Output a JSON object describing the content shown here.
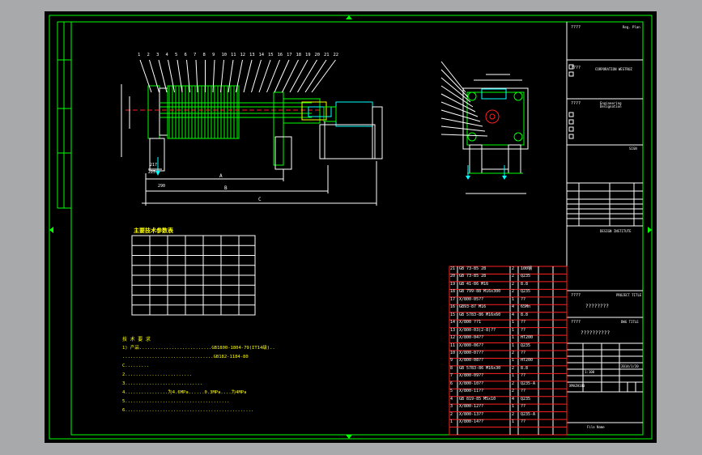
{
  "drawing": {
    "title_block": {
      "top_label": "????",
      "reg_label": "Reg. Plan",
      "corp_label": "????",
      "corp_text": "CORPORATION WESTRUZ",
      "eng_label": "????",
      "eng_text": "Engineering Designation",
      "sig_label": "SIGN",
      "design_label": "DESIGN INSTITUTE",
      "project_label": "????",
      "project_text": "PROJECT TITLE",
      "project_value": "????????",
      "dwg_label": "????",
      "dwg_text": "DWG TITLE",
      "dwg_value": "??????????",
      "model_value": "XMAZH180",
      "ratio_value": "1:100",
      "date_value": "2014/1/20",
      "file_label": "File Name"
    },
    "param_table": {
      "title": "主要技术参数表",
      "rows": 7
    },
    "notes": {
      "title": "技 术 要 求",
      "lines": [
        "1) 产品...........................GB1800-1804-79(IT14级)..",
        "   ..................................GB182-1184-80",
        "C.........",
        "2.........................",
        "3.............................",
        "4................为4.6MPa......0.3MPa....为4MPa",
        "5.......................................",
        "6................................................"
      ]
    },
    "part_numbers_left": [
      "1",
      "2",
      "3",
      "4",
      "5",
      "6",
      "7",
      "8",
      "9",
      "10",
      "11",
      "12",
      "13",
      "14",
      "15",
      "16",
      "17",
      "18",
      "19",
      "20",
      "21",
      "22"
    ],
    "dims": {
      "A": "A",
      "B": "B",
      "C": "C",
      "d217": "217",
      "d225": "225",
      "d290": "290"
    },
    "bom": [
      {
        "no": "21",
        "code": "GB 73-85 28",
        "qty": "2",
        "mat": "100钢"
      },
      {
        "no": "20",
        "code": "GB 73-85 28",
        "qty": "2",
        "mat": "Q235"
      },
      {
        "no": "19",
        "code": "GB 41-86 M16",
        "qty": "2",
        "mat": "8.8"
      },
      {
        "no": "18",
        "code": "GB 799-88 M16x300",
        "qty": "2",
        "mat": "Q235"
      },
      {
        "no": "17",
        "code": "X/800-05??",
        "qty": "1",
        "mat": "??"
      },
      {
        "no": "16",
        "code": "GB93-87 M16",
        "qty": "4",
        "mat": "65Mn"
      },
      {
        "no": "15",
        "code": "GB 5783-86 M16x60",
        "qty": "4",
        "mat": "8.8"
      },
      {
        "no": "14",
        "code": "X/800 ??1",
        "qty": "1",
        "mat": "??"
      },
      {
        "no": "13",
        "code": "X/800-03(2-8)??",
        "qty": "1",
        "mat": "??"
      },
      {
        "no": "12",
        "code": "X/800-04??",
        "qty": "1",
        "mat": "HT200"
      },
      {
        "no": "11",
        "code": "X/800-06??",
        "qty": "1",
        "mat": "Q235"
      },
      {
        "no": "10",
        "code": "X/800-07??",
        "qty": "2",
        "mat": "??"
      },
      {
        "no": "9",
        "code": "X/800-08??",
        "qty": "1",
        "mat": "HT200"
      },
      {
        "no": "8",
        "code": "GB 5783-86 M16x30",
        "qty": "2",
        "mat": "8.8"
      },
      {
        "no": "7",
        "code": "X/800-09??",
        "qty": "1",
        "mat": "??"
      },
      {
        "no": "6",
        "code": "X/800-10??",
        "qty": "2",
        "mat": "Q235-A"
      },
      {
        "no": "5",
        "code": "X/800-11??",
        "qty": "2",
        "mat": "??"
      },
      {
        "no": "4",
        "code": "GB 819-85 M5x10",
        "qty": "4",
        "mat": "Q235"
      },
      {
        "no": "3",
        "code": "X/800-12??",
        "qty": "1",
        "mat": "??"
      },
      {
        "no": "2",
        "code": "X/800-13??",
        "qty": "2",
        "mat": "Q235-A"
      },
      {
        "no": "1",
        "code": "X/800-14??",
        "qty": "1",
        "mat": "??"
      }
    ]
  }
}
